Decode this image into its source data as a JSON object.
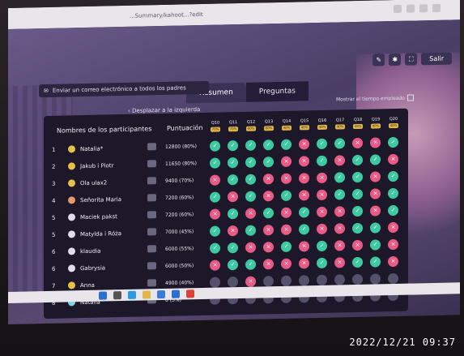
{
  "browser": {
    "url": "...Summary/kahoot...?edit"
  },
  "toolbar": {
    "exit_label": "Salir"
  },
  "tabs": [
    {
      "label": "Resumen",
      "active": true
    },
    {
      "label": "Preguntas",
      "active": false
    }
  ],
  "email_button": {
    "label": "Enviar un correo electrónico a todos los padres"
  },
  "scroll_hint": {
    "label": "Desplazar a la izquierda"
  },
  "time_toggle": {
    "label": "Mostrar el tiempo empleado"
  },
  "leaderboard": {
    "header_names": "Nombres de los participantes",
    "header_score": "Puntuación",
    "questions": [
      {
        "label": "Q10",
        "pct": "70%"
      },
      {
        "label": "Q11",
        "pct": "70%"
      },
      {
        "label": "Q12",
        "pct": "60%"
      },
      {
        "label": "Q13",
        "pct": "60%"
      },
      {
        "label": "Q14",
        "pct": "40%"
      },
      {
        "label": "Q15",
        "pct": "40%"
      },
      {
        "label": "Q16",
        "pct": "40%"
      },
      {
        "label": "Q17",
        "pct": "40%"
      },
      {
        "label": "Q18",
        "pct": "40%"
      },
      {
        "label": "Q19",
        "pct": "40%"
      },
      {
        "label": "Q20",
        "pct": "40%"
      }
    ],
    "rows": [
      {
        "rank": "1",
        "name": "Natalia*",
        "score": "12800 (80%)",
        "avatar": "#e6c14a",
        "answers": [
          "ok",
          "ok",
          "ok",
          "ok",
          "ok",
          "bad",
          "ok",
          "ok",
          "bad",
          "bad",
          "ok"
        ]
      },
      {
        "rank": "2",
        "name": "Jakub i Piotr",
        "score": "11650 (80%)",
        "avatar": "#e6c14a",
        "answers": [
          "ok",
          "ok",
          "ok",
          "ok",
          "bad",
          "bad",
          "ok",
          "bad",
          "ok",
          "ok",
          "bad"
        ]
      },
      {
        "rank": "3",
        "name": "Ola ulax2",
        "score": "9400 (70%)",
        "avatar": "#e6c14a",
        "answers": [
          "bad",
          "ok",
          "ok",
          "bad",
          "bad",
          "bad",
          "bad",
          "ok",
          "ok",
          "bad",
          "ok"
        ]
      },
      {
        "rank": "4",
        "name": "Señorita Maria",
        "score": "7200 (60%)",
        "avatar": "#e79a6a",
        "answers": [
          "ok",
          "bad",
          "ok",
          "bad",
          "ok",
          "bad",
          "bad",
          "ok",
          "ok",
          "bad",
          "ok"
        ]
      },
      {
        "rank": "5",
        "name": "Maciek pakst",
        "score": "7200 (60%)",
        "avatar": "#e0dcec",
        "answers": [
          "bad",
          "ok",
          "bad",
          "ok",
          "bad",
          "ok",
          "bad",
          "bad",
          "ok",
          "bad",
          "ok"
        ]
      },
      {
        "rank": "5",
        "name": "Matylda i Róża",
        "score": "7000 (45%)",
        "avatar": "#e0dcec",
        "answers": [
          "ok",
          "bad",
          "ok",
          "bad",
          "bad",
          "ok",
          "bad",
          "bad",
          "ok",
          "ok",
          "bad"
        ]
      },
      {
        "rank": "6",
        "name": "klaudia",
        "score": "6000 (55%)",
        "avatar": "#e0dcec",
        "answers": [
          "ok",
          "ok",
          "bad",
          "bad",
          "ok",
          "bad",
          "ok",
          "bad",
          "bad",
          "ok",
          "bad"
        ]
      },
      {
        "rank": "6",
        "name": "Gabrysia",
        "score": "6000 (50%)",
        "avatar": "#e0dcec",
        "answers": [
          "bad",
          "ok",
          "ok",
          "bad",
          "bad",
          "bad",
          "ok",
          "bad",
          "ok",
          "ok",
          "bad"
        ]
      },
      {
        "rank": "7",
        "name": "Anna",
        "score": "4900 (40%)",
        "avatar": "#e6c14a",
        "answers": [
          "na",
          "na",
          "bad",
          "na",
          "na",
          "na",
          "na",
          "na",
          "na",
          "na",
          "na"
        ]
      },
      {
        "rank": "8",
        "name": "Natalia",
        "score": "0 (5%)",
        "avatar": "#7fd3e0",
        "answers": [
          "na",
          "na",
          "na",
          "na",
          "na",
          "na",
          "na",
          "na",
          "na",
          "na",
          "na"
        ]
      }
    ]
  },
  "timestamp": "2022/12/21 09:37",
  "colors": {
    "correct": "#3ec9a2",
    "incorrect": "#e85b86",
    "unanswered": "#54516a",
    "pct_badge": "#e3b64c"
  },
  "taskbar_icons": [
    "windows-icon",
    "search-icon",
    "edge-icon",
    "folder-icon",
    "store-icon",
    "mail-icon",
    "chrome-icon"
  ]
}
